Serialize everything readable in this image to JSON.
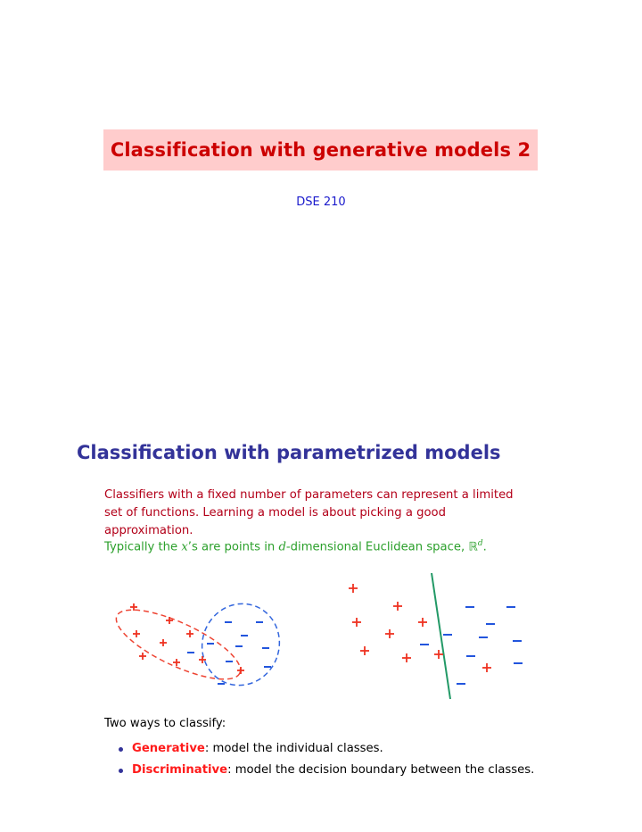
{
  "slide1": {
    "title": "Classification with generative models 2",
    "subtitle": "DSE 210"
  },
  "slide2": {
    "heading": "Classification with parametrized models",
    "paragraph1": "Classifiers with a fixed number of parameters can represent a limited set of functions. Learning a model is about picking a good approximation.",
    "paragraph2_prefix": "Typically the ",
    "paragraph2_var_x": "x",
    "paragraph2_mid1": "’s are points in ",
    "paragraph2_var_d": "d",
    "paragraph2_mid2": "-dimensional Euclidean space, ",
    "paragraph2_space": "ℝ",
    "paragraph2_sup": "d",
    "paragraph2_end": ".",
    "ways_intro": "Two ways to classify:",
    "bullets": [
      {
        "term": "Generative",
        "rest": ": model the individual classes."
      },
      {
        "term": "Discriminative",
        "rest": ": model the decision boundary between the classes."
      }
    ],
    "figure": {
      "plus_symbol": "+",
      "minus_symbol": "–",
      "colors": {
        "plus": "#ee3322",
        "minus": "#2255dd",
        "boundary": "#229966",
        "ellipse_plus": "#ee4433",
        "ellipse_minus": "#3366dd"
      }
    }
  }
}
